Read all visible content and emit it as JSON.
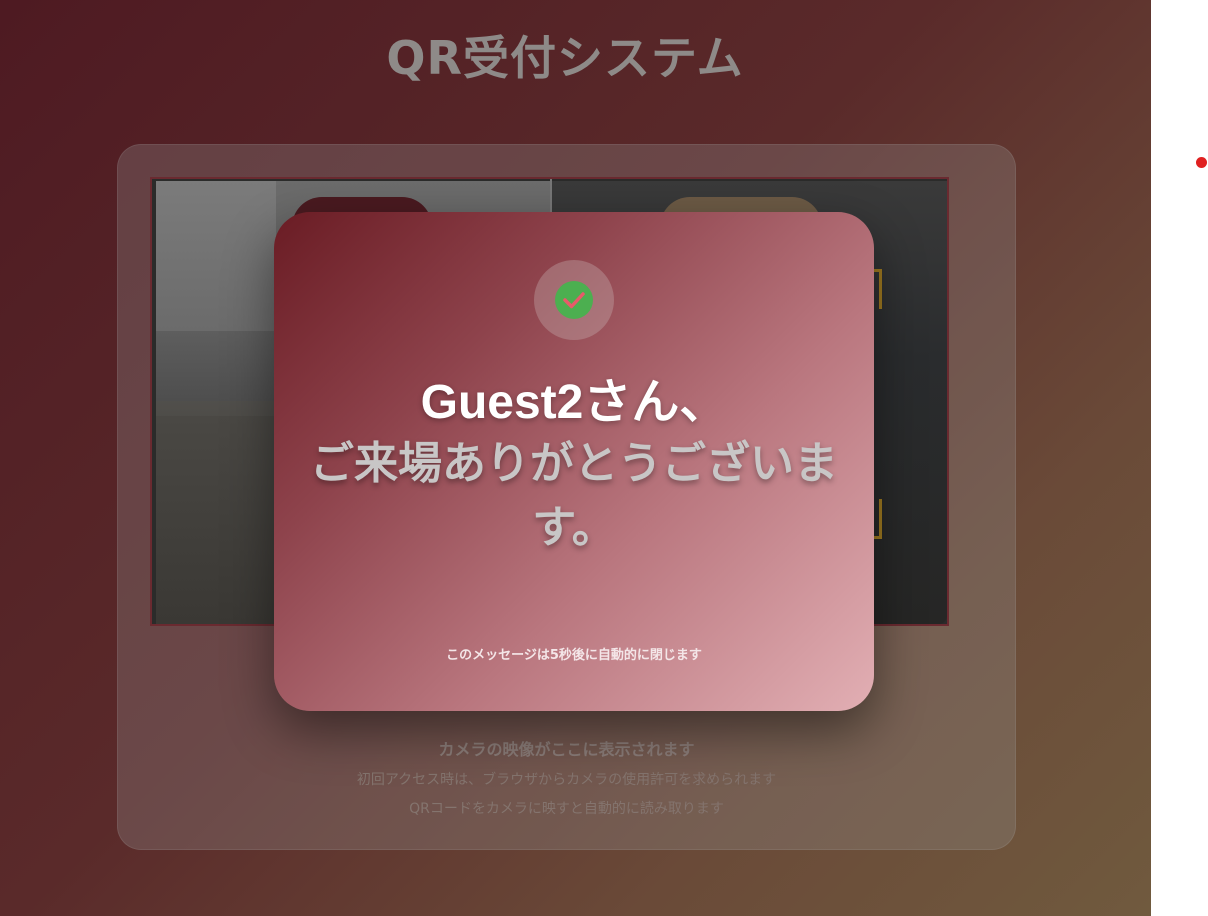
{
  "app": {
    "title": "QR受付システム"
  },
  "scanner": {
    "caption_main": "カメラの映像がここに表示されます",
    "caption_sub1": "初回アクセス時は、ブラウザからカメラの使用許可を求められます",
    "caption_sub2": "QRコードをカメラに映すと自動的に読み取ります"
  },
  "modal": {
    "icon": "check-circle-icon",
    "greeting_name": "Guest2さん、",
    "greeting_message": "ご来場ありがとうございます。",
    "auto_close_note": "このメッセージは5秒後に自動的に閉じます"
  },
  "colors": {
    "success_green": "#4caf50",
    "indicator_red": "#e02020"
  }
}
